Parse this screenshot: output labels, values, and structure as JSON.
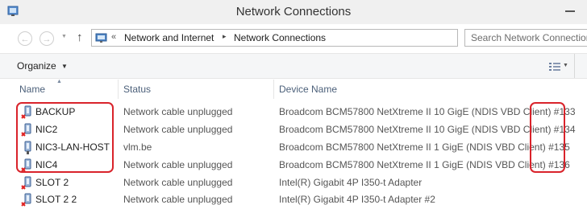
{
  "window": {
    "title": "Network Connections"
  },
  "nav": {
    "back_glyph": "←",
    "forward_glyph": "→",
    "up_glyph": "↑",
    "address_prefix": "«",
    "breadcrumbs": [
      "Network and Internet",
      "Network Connections"
    ],
    "separator": "▸",
    "search_placeholder": "Search Network Connections"
  },
  "toolbar": {
    "organize_label": "Organize",
    "dropdown_glyph": "▼"
  },
  "columns": {
    "name": "Name",
    "status": "Status",
    "device": "Device Name",
    "sort_glyph": "▲"
  },
  "rows": [
    {
      "name": "BACKUP",
      "status": "Network cable unplugged",
      "device": "Broadcom BCM57800 NetXtreme II 10 GigE (NDIS VBD Client) #133",
      "icon": "network-adapter-disconnected-icon"
    },
    {
      "name": "NIC2",
      "status": "Network cable unplugged",
      "device": "Broadcom BCM57800 NetXtreme II 10 GigE (NDIS VBD Client) #134",
      "icon": "network-adapter-disconnected-icon"
    },
    {
      "name": "NIC3-LAN-HOST",
      "status": "vlm.be",
      "device": "Broadcom BCM57800 NetXtreme II 1 GigE (NDIS VBD Client) #135",
      "icon": "network-adapter-icon"
    },
    {
      "name": "NIC4",
      "status": "Network cable unplugged",
      "device": "Broadcom BCM57800 NetXtreme II 1 GigE (NDIS VBD Client) #136",
      "icon": "network-adapter-disconnected-icon"
    },
    {
      "name": "SLOT 2",
      "status": "Network cable unplugged",
      "device": "Intel(R) Gigabit 4P I350-t Adapter",
      "icon": "network-adapter-disconnected-icon"
    },
    {
      "name": "SLOT 2 2",
      "status": "Network cable unplugged",
      "device": "Intel(R) Gigabit 4P I350-t Adapter #2",
      "icon": "network-adapter-disconnected-icon"
    }
  ],
  "colors": {
    "annotation": "#d9232b",
    "column_header": "#4c607a",
    "selection_border": "#b8b8b8"
  }
}
